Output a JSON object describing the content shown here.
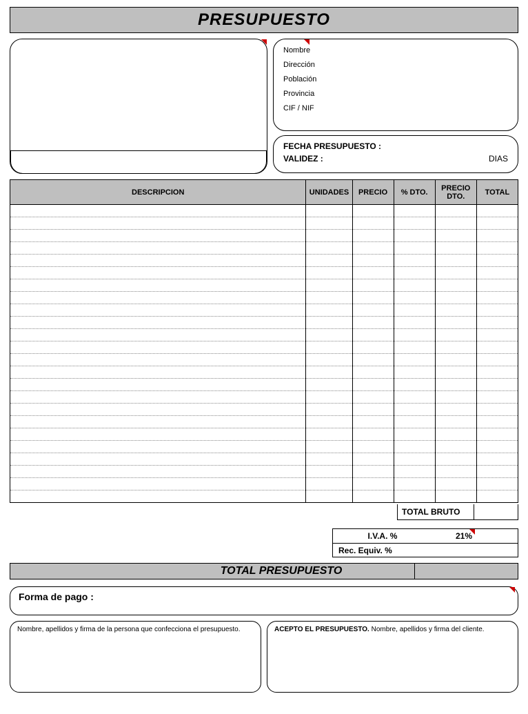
{
  "title": "PRESUPUESTO",
  "client_fields": {
    "nombre": "Nombre",
    "direccion": "Dirección",
    "poblacion": "Población",
    "provincia": "Provincia",
    "cif": "CIF / NIF"
  },
  "date_box": {
    "fecha_label": "FECHA PRESUPUESTO :",
    "validez_label": "VALIDEZ :",
    "dias": "DIAS"
  },
  "columns": {
    "descripcion": "DESCRIPCION",
    "unidades": "UNIDADES",
    "precio": "PRECIO",
    "pct_dto": "% DTO.",
    "precio_dto": "PRECIO DTO.",
    "total": "TOTAL"
  },
  "totals": {
    "bruto_label": "TOTAL BRUTO",
    "iva_label": "I.V.A. %",
    "iva_pct": "21%",
    "rec_label": "Rec. Equiv. %",
    "total_label": "TOTAL PRESUPUESTO"
  },
  "payment": {
    "label": "Forma de pago :"
  },
  "signatures": {
    "seller": "Nombre, apellidos y firma de la persona que confecciona el presupuesto.",
    "buyer_bold": "ACEPTO EL PRESUPUESTO.",
    "buyer_rest": " Nombre, apellidos y firma del cliente."
  }
}
